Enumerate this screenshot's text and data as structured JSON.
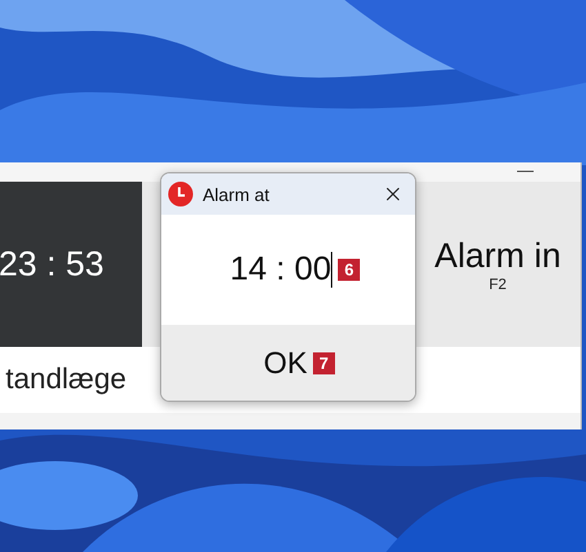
{
  "main_window": {
    "clock": "23 : 53",
    "alarm_in": {
      "label": "Alarm in",
      "shortcut": "F2"
    },
    "note": "tandlæge"
  },
  "dialog": {
    "title": "Alarm at",
    "time_field": {
      "value": "14 : 00",
      "callout": "6"
    },
    "ok_button": {
      "label": "OK",
      "callout": "7"
    }
  }
}
